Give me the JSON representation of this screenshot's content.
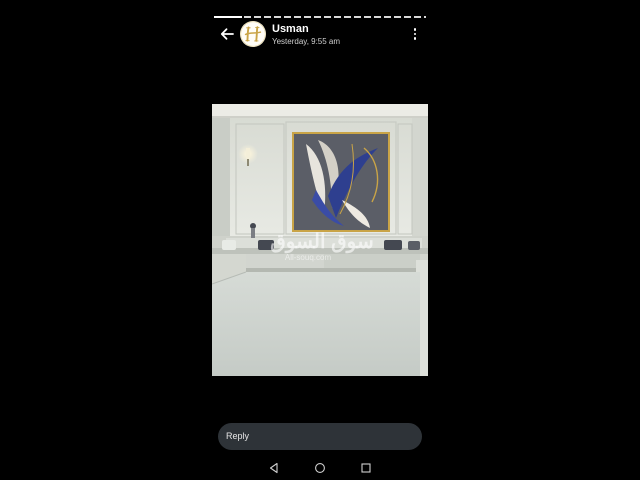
{
  "status": {
    "progress_fraction": 0.13
  },
  "header": {
    "contact_name": "Usman",
    "timestamp": "Yesterday, 9:55 am",
    "avatar_icon": "gold-letter-h-logo-icon",
    "back_icon": "arrow-left-icon",
    "menu_icon": "more-vertical-icon"
  },
  "media": {
    "watermark_arabic": "سوق السوق",
    "watermark_latin": "All-souq.com"
  },
  "reply": {
    "placeholder": "Reply"
  },
  "nav": {
    "back_icon": "triangle-back-icon",
    "home_icon": "circle-home-icon",
    "recents_icon": "square-recents-icon"
  },
  "colors": {
    "accent_gold": "#c9a447",
    "reply_bg": "#2e3338"
  }
}
